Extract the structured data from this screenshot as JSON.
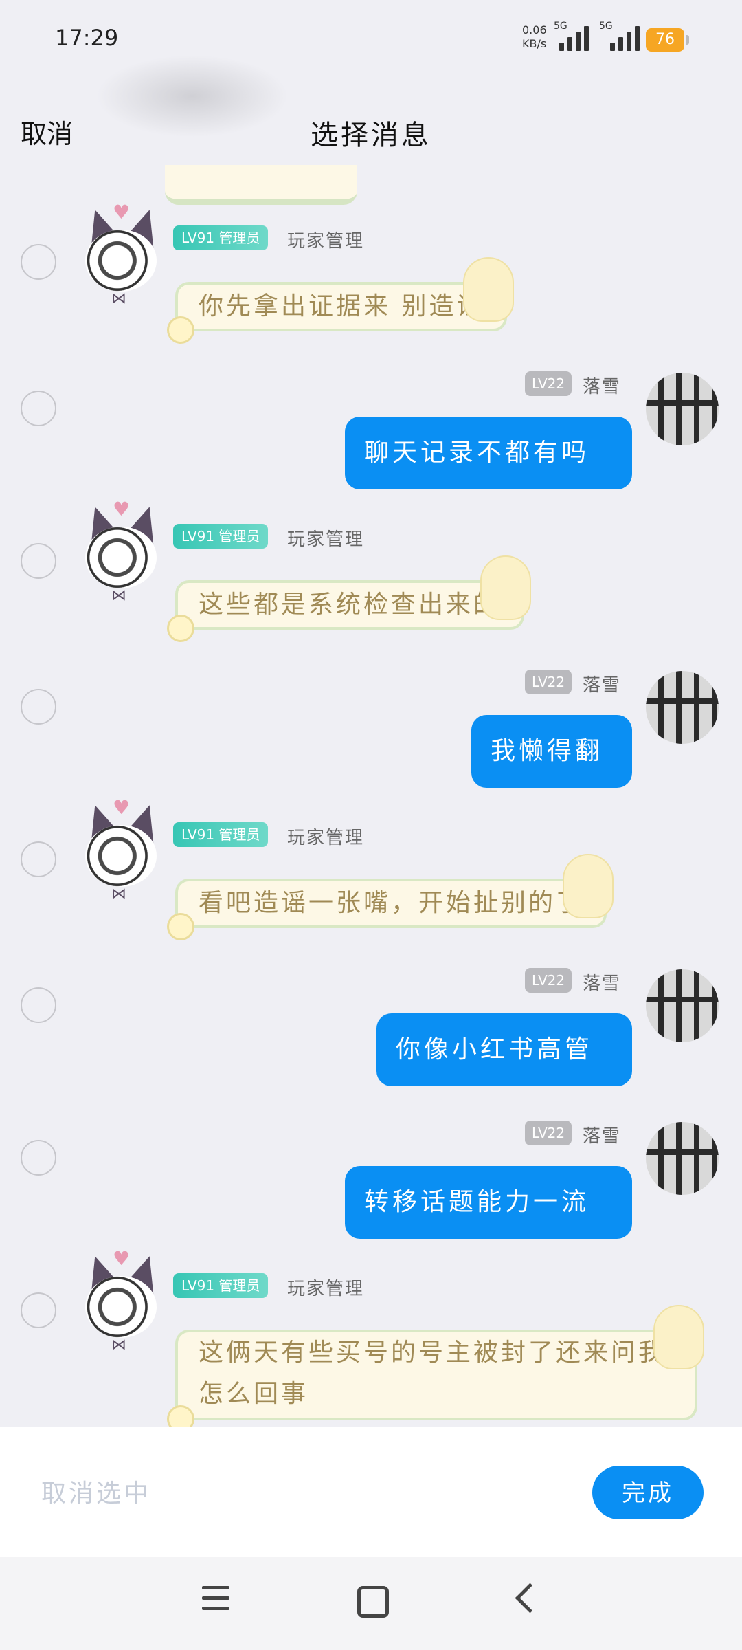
{
  "status_bar": {
    "time": "17:29",
    "net_speed_value": "0.06",
    "net_speed_unit": "KB/s",
    "sim1_type": "5G",
    "sim2_type": "5G",
    "battery": "76",
    "battery_color": "#f6a623"
  },
  "header": {
    "cancel_label": "取消",
    "title": "选择消息"
  },
  "messages": [
    {
      "side": "left",
      "level": "LV91 管理员",
      "name": "玩家管理",
      "text": "你先拿出证据来 别造谣"
    },
    {
      "side": "right",
      "level": "LV22",
      "name": "落雪",
      "text": "聊天记录不都有吗"
    },
    {
      "side": "left",
      "level": "LV91 管理员",
      "name": "玩家管理",
      "text": "这些都是系统检查出来的"
    },
    {
      "side": "right",
      "level": "LV22",
      "name": "落雪",
      "text": "我懒得翻"
    },
    {
      "side": "left",
      "level": "LV91 管理员",
      "name": "玩家管理",
      "text": "看吧造谣一张嘴，开始扯别的了"
    },
    {
      "side": "right",
      "level": "LV22",
      "name": "落雪",
      "text": "你像小红书高管"
    },
    {
      "side": "right",
      "level": "LV22",
      "name": "落雪",
      "text": "转移话题能力一流"
    },
    {
      "side": "left",
      "level": "LV91 管理员",
      "name": "玩家管理",
      "text": "这俩天有些买号的号主被封了还来问我怎么回事"
    }
  ],
  "bottom": {
    "deselect_label": "取消选中",
    "done_label": "完成"
  },
  "colors": {
    "accent_blue": "#0a8ff3",
    "admin_badge": "#37c6b4",
    "background": "#efeff4"
  },
  "icons": {
    "nav_menu": "menu-icon",
    "nav_home": "home-icon",
    "nav_back": "back-icon"
  }
}
